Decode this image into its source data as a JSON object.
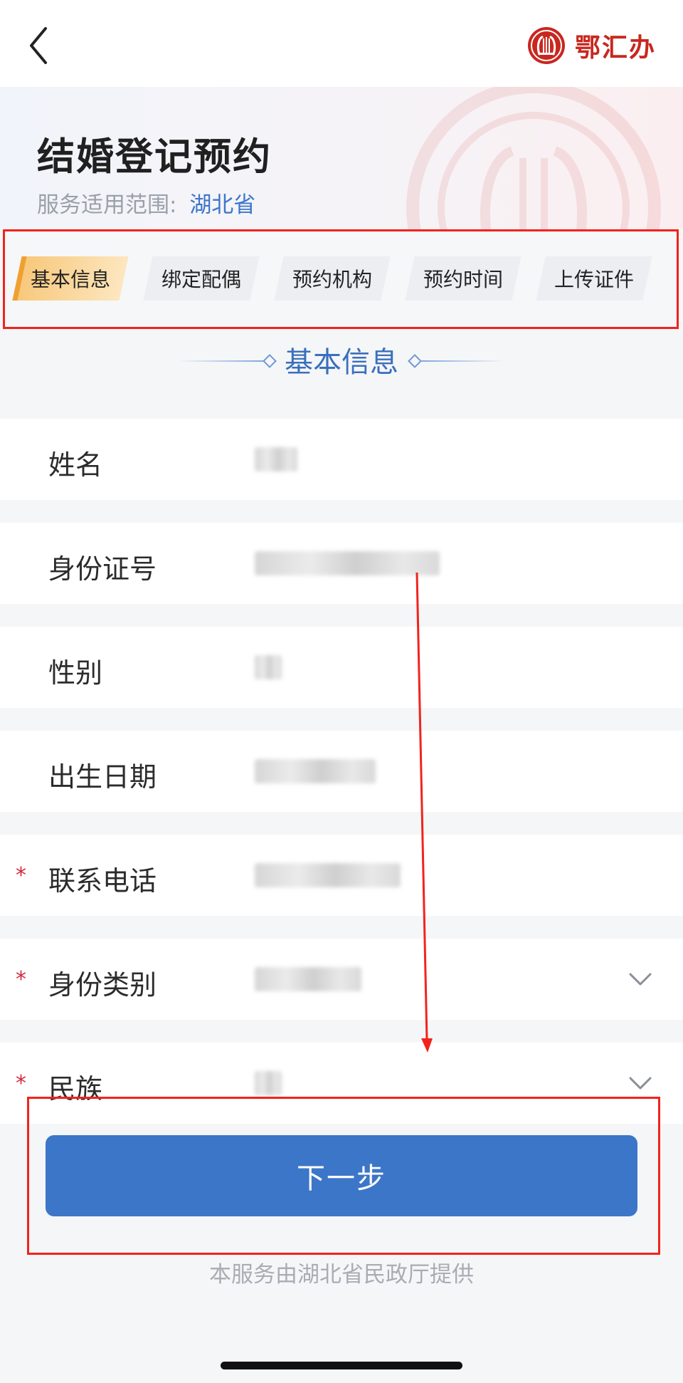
{
  "header": {
    "back_icon": "chevron-left-icon",
    "brand_icon": "lyre-logo-icon",
    "brand_name": "鄂汇办"
  },
  "hero": {
    "title": "结婚登记预约",
    "scope_label": "服务适用范围:",
    "scope_value": "湖北省"
  },
  "steps": [
    {
      "label": "基本信息",
      "active": true
    },
    {
      "label": "绑定配偶",
      "active": false
    },
    {
      "label": "预约机构",
      "active": false
    },
    {
      "label": "预约时间",
      "active": false
    },
    {
      "label": "上传证件",
      "active": false
    }
  ],
  "section": {
    "title": "基本信息"
  },
  "form": {
    "required_mark": "*",
    "fields": [
      {
        "label": "姓名",
        "required": false,
        "has_dropdown": false,
        "redacted": true
      },
      {
        "label": "身份证号",
        "required": false,
        "has_dropdown": false,
        "redacted": true
      },
      {
        "label": "性别",
        "required": false,
        "has_dropdown": false,
        "redacted": true
      },
      {
        "label": "出生日期",
        "required": false,
        "has_dropdown": false,
        "redacted": true
      },
      {
        "label": "联系电话",
        "required": true,
        "has_dropdown": false,
        "redacted": true
      },
      {
        "label": "身份类别",
        "required": true,
        "has_dropdown": true,
        "redacted": true
      },
      {
        "label": "民族",
        "required": true,
        "has_dropdown": true,
        "redacted": true
      }
    ]
  },
  "actions": {
    "next_label": "下一步"
  },
  "footer": {
    "text": "本服务由湖北省民政厅提供"
  },
  "colors": {
    "accent": "#3c76c8",
    "brand": "#c8271f",
    "required": "#d6293a",
    "annotation": "#f2231d",
    "active_step": "#f7c779"
  }
}
